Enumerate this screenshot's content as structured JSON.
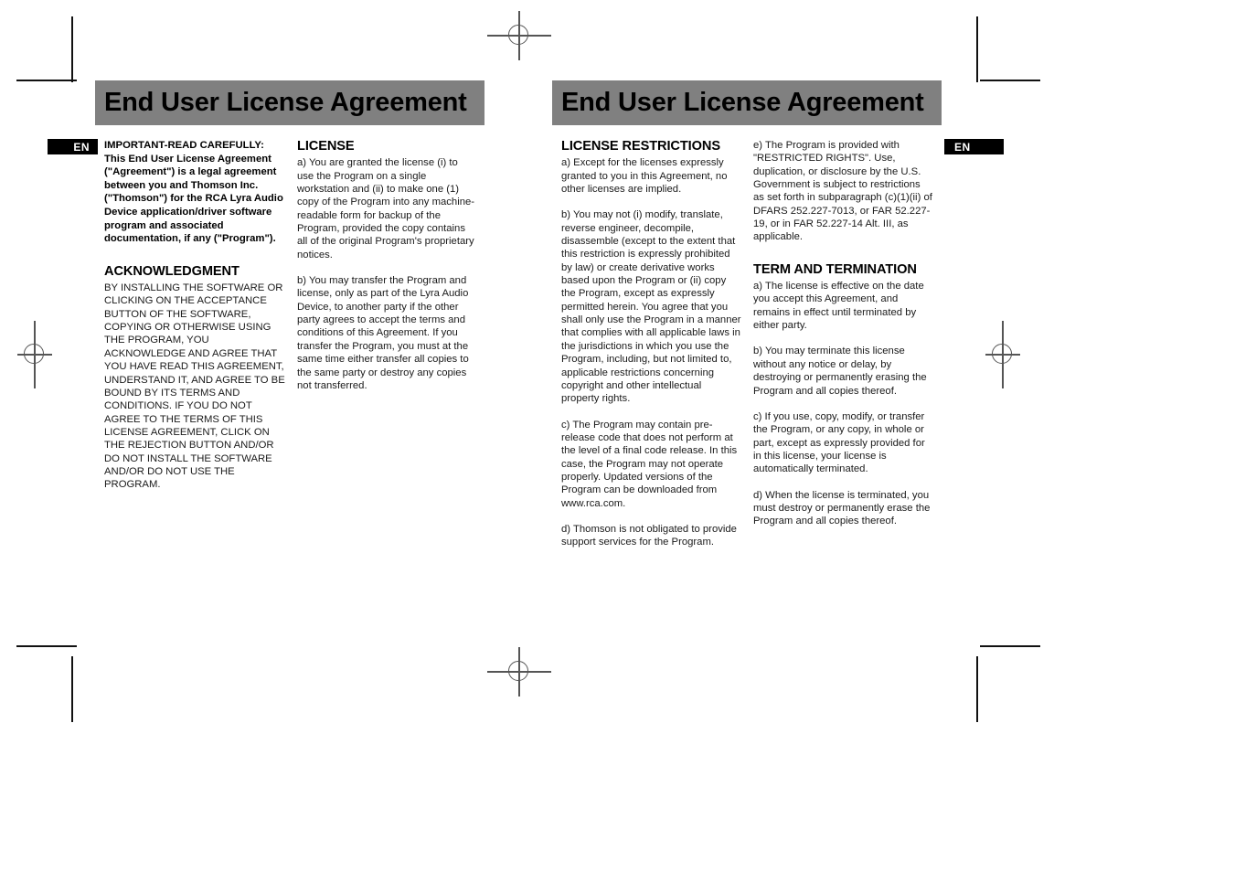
{
  "document": {
    "title": "End User License Agreement",
    "language_badge": "EN",
    "banner_color": "#808080",
    "badge_color": "#000000"
  },
  "left_page": {
    "banner_title": "End User License Agreement",
    "badge": "EN",
    "column1": {
      "lead": "IMPORTANT-READ CAREFULLY:  This End User License Agreement (\"Agreement\") is a legal agreement between you and Thomson Inc. (\"Thomson\") for the RCA Lyra Audio Device application/driver software program and associated documentation, if any (\"Program\").",
      "heading": "ACKNOWLEDGMENT",
      "body": "BY INSTALLING THE SOFTWARE OR CLICKING ON THE ACCEPTANCE BUTTON OF THE SOFTWARE, COPYING OR OTHERWISE USING THE PROGRAM, YOU ACKNOWLEDGE AND AGREE THAT YOU HAVE READ THIS AGREEMENT, UNDERSTAND IT, AND AGREE TO BE BOUND BY ITS TERMS AND CONDITIONS. IF YOU DO NOT AGREE TO THE TERMS OF THIS LICENSE AGREEMENT, CLICK ON THE REJECTION BUTTON AND/OR DO NOT INSTALL THE SOFTWARE AND/OR DO NOT USE THE PROGRAM."
    },
    "column2": {
      "heading": "LICENSE",
      "item_a": "a)    You are granted the license (i) to use the Program on a single workstation and (ii) to make one (1) copy of the Program into any machine-readable form for backup of the Program, provided the copy contains all of the original Program's proprietary notices.",
      "item_b": "b) You may transfer the Program and license, only as part of the Lyra Audio Device, to another party if the other party agrees to accept the terms and conditions of this Agreement.  If you transfer the Program, you must at the same time either transfer all copies to the same party or destroy any copies not transferred."
    }
  },
  "right_page": {
    "banner_title": "End User License Agreement",
    "badge": "EN",
    "column3": {
      "heading": "LICENSE RESTRICTIONS",
      "item_a": "a)  Except for the licenses expressly granted to you in this Agreement, no other licenses are implied.",
      "item_b": "b)  You may not (i) modify, translate, reverse engineer, decompile, disassemble (except to the extent that this restriction is expressly prohibited by law) or create derivative works based upon the Program or (ii) copy the Program, except as expressly permitted herein.  You agree that you shall only use the Program in a manner that complies with all applicable laws in the jurisdictions in which you use the Program, including, but not limited to, applicable restrictions concerning copyright and other intellectual property rights.",
      "item_c": "c)  The Program may contain pre-release code that does not perform at the level of a final code release.  In this case, the Program may not operate properly.  Updated versions of the Program can be downloaded from www.rca.com.",
      "item_d": "d)  Thomson is not obligated to provide support services for the Program."
    },
    "column4": {
      "item_e": "e)  The Program is provided with \"RESTRICTED RIGHTS\". Use, duplication, or disclosure by the U.S. Government is subject to restrictions as set forth in subparagraph (c)(1)(ii) of DFARS 252.227-7013, or FAR 52.227-19, or in FAR 52.227-14 Alt. III, as applicable.",
      "heading": "TERM AND TERMINATION",
      "item_a": "a) The license is effective on the date you accept this Agreement, and remains in effect until terminated by either party.",
      "item_b": "b) You may terminate this license without any notice or delay, by destroying or permanently erasing the Program and all copies thereof.",
      "item_c": "c) If you use, copy, modify, or transfer the Program, or any copy, in whole or part, except as expressly provided for in this license, your license is automatically terminated.",
      "item_d": "d) When the license is terminated, you must destroy or permanently erase the Program and all copies thereof."
    }
  }
}
